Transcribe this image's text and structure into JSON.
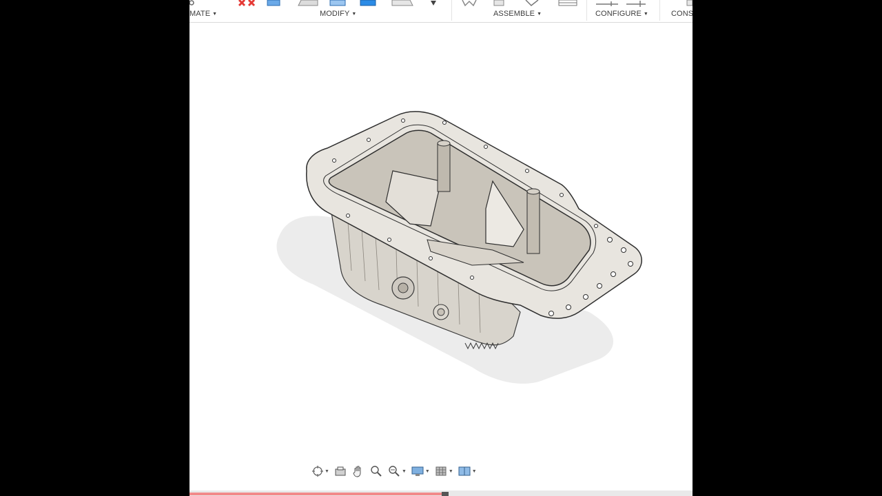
{
  "toolbar": {
    "groups": [
      {
        "label": "MATE",
        "caret": "▼"
      },
      {
        "label": "MODIFY",
        "caret": "▼"
      },
      {
        "label": "ASSEMBLE",
        "caret": "▼"
      },
      {
        "label": "CONFIGURE",
        "caret": "▼"
      },
      {
        "label": "CONS"
      }
    ]
  },
  "navbar": {
    "items": [
      {
        "icon": "orbit-icon",
        "has_menu": true
      },
      {
        "icon": "look-at-icon",
        "has_menu": false
      },
      {
        "icon": "pan-hand-icon",
        "has_menu": false
      },
      {
        "icon": "zoom-icon",
        "has_menu": false
      },
      {
        "icon": "zoom-window-icon",
        "has_menu": true
      },
      {
        "icon": "display-settings-icon",
        "has_menu": true
      },
      {
        "icon": "grid-icon",
        "has_menu": true
      },
      {
        "icon": "viewports-icon",
        "has_menu": true
      }
    ]
  },
  "viewport": {
    "model_icon": "oil-pan-model"
  },
  "progress": {
    "played_fraction": 0.508,
    "fill_color": "#f28a8a"
  },
  "colors": {
    "accent_red": "#e53935",
    "accent_blue": "#2b8be6",
    "model_fill": "#e8e5df",
    "model_shade": "#cfcac2"
  }
}
